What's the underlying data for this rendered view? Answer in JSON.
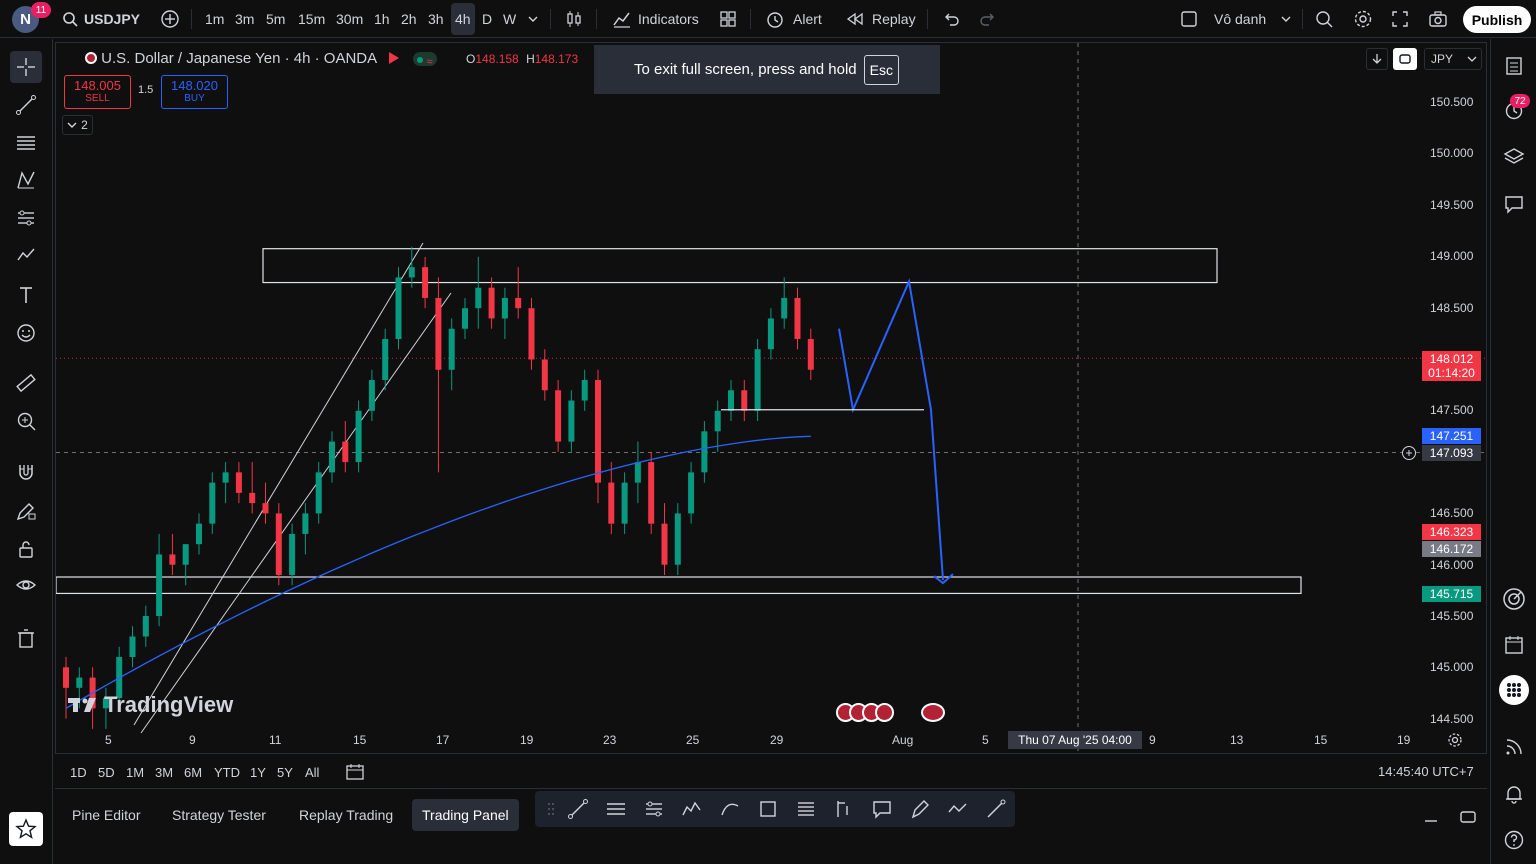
{
  "account": {
    "initial": "N",
    "badge": "11"
  },
  "toolbar": {
    "symbol": "USDJPY",
    "intervals": [
      "1m",
      "3m",
      "5m",
      "15m",
      "30m",
      "1h",
      "2h",
      "3h",
      "4h",
      "D",
      "W"
    ],
    "active_interval": "4h",
    "indicators_label": "Indicators",
    "alert_label": "Alert",
    "replay_label": "Replay",
    "layout_name": "Vô danh",
    "publish_label": "Publish"
  },
  "legend": {
    "title": "U.S. Dollar / Japanese Yen · 4h · OANDA",
    "open_label": "O",
    "open_value": "148.158",
    "high_label": "H",
    "high_value": "148.173",
    "sell_price": "148.005",
    "sell_label": "SELL",
    "spread": "1.5",
    "buy_price": "148.020",
    "buy_label": "BUY",
    "collapse_count": "2"
  },
  "fullscreen_toast": {
    "text": "To exit full screen, press and hold",
    "key": "Esc"
  },
  "currency": "JPY",
  "price_axis": {
    "ticks": [
      "150.500",
      "150.000",
      "149.500",
      "149.000",
      "148.500",
      "148.000",
      "147.500",
      "147.000",
      "146.500",
      "146.000",
      "145.500",
      "145.000",
      "144.500"
    ],
    "labels": [
      {
        "value": "148.012",
        "sub": "01:14:20",
        "color": "#f23645"
      },
      {
        "value": "147.251",
        "color": "#2962ff"
      },
      {
        "value": "147.093",
        "color": "#363a45"
      },
      {
        "value": "146.323",
        "color": "#f23645"
      },
      {
        "value": "146.172",
        "color": "#787b86"
      },
      {
        "value": "145.715",
        "color": "#089981"
      }
    ]
  },
  "time_axis": {
    "ticks": [
      "5",
      "9",
      "11",
      "15",
      "17",
      "19",
      "23",
      "25",
      "29",
      "Aug",
      "5",
      "9",
      "13",
      "15",
      "19"
    ],
    "crosshair": "Thu 07 Aug '25   04:00"
  },
  "watermark": "TradingView",
  "range_bar": {
    "ranges": [
      "1D",
      "5D",
      "1M",
      "3M",
      "6M",
      "YTD",
      "1Y",
      "5Y",
      "All"
    ],
    "clock": "14:45:40 UTC+7"
  },
  "bottom_tabs": [
    "Pine Editor",
    "Strategy Tester",
    "Replay Trading",
    "Trading Panel"
  ],
  "active_bottom_tab": "Trading Panel",
  "right_toolbar": {
    "notification_badge": "72"
  },
  "chart_data": {
    "type": "candlestick",
    "symbol": "USDJPY",
    "interval": "4h",
    "ylim": [
      144.4,
      150.8
    ],
    "current_price": 148.012,
    "ma_series_name": "",
    "ma_last_value": 147.251,
    "zones": [
      {
        "name": "resistance",
        "top": 149.08,
        "bottom": 148.75
      },
      {
        "name": "support",
        "top": 145.88,
        "bottom": 145.72
      }
    ],
    "projection": [
      148.3,
      147.51,
      148.76,
      147.51,
      145.85
    ]
  }
}
